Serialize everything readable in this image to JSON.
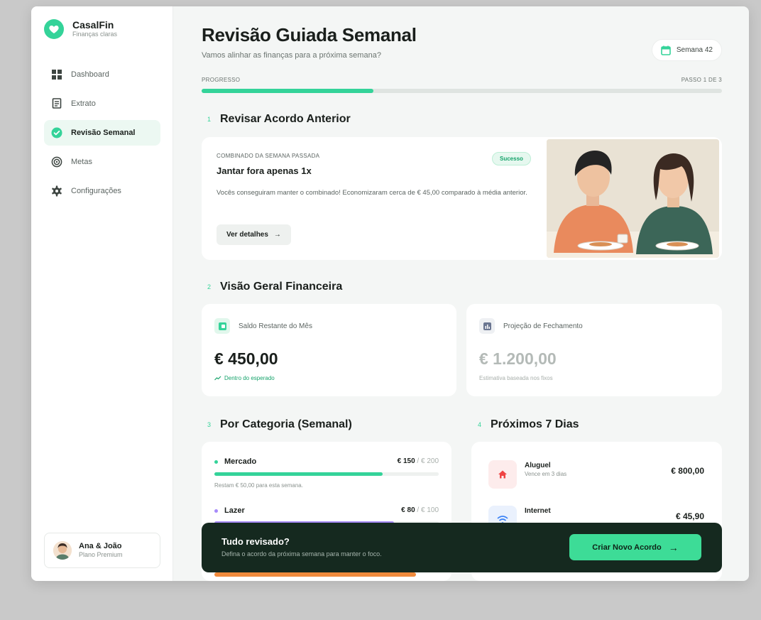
{
  "app": {
    "name": "CasalFin",
    "tagline": "Finanças claras"
  },
  "sidebar": {
    "items": [
      {
        "label": "Dashboard",
        "icon": "dashboard-icon",
        "active": false
      },
      {
        "label": "Extrato",
        "icon": "receipt-icon",
        "active": false
      },
      {
        "label": "Revisão Semanal",
        "icon": "check-circle-icon",
        "active": true
      },
      {
        "label": "Metas",
        "icon": "target-icon",
        "active": false
      },
      {
        "label": "Configurações",
        "icon": "gear-icon",
        "active": false
      }
    ],
    "user": {
      "name": "Ana & João",
      "plan": "Plano Premium"
    }
  },
  "header": {
    "title": "Revisão Guiada Semanal",
    "subtitle": "Vamos alinhar as finanças para a próxima semana?",
    "week_label": "Semana 42"
  },
  "progress": {
    "label": "PROGRESSO",
    "step_label": "PASSO 1 DE 3",
    "value": 0.33
  },
  "sections": {
    "agreement": {
      "number": "1",
      "title": "Revisar Acordo Anterior"
    },
    "overview": {
      "number": "2",
      "title": "Visão Geral Financeira"
    },
    "categories": {
      "number": "3",
      "title": "Por Categoria (Semanal)"
    },
    "upcoming": {
      "number": "4",
      "title": "Próximos 7 Dias"
    }
  },
  "agreement": {
    "tag": "COMBINADO DA SEMANA PASSADA",
    "title": "Jantar fora apenas 1x",
    "badge": "Sucesso",
    "description": "Vocês conseguiram manter o combinado! Economizaram cerca de € 45,00 comparado à média anterior.",
    "button_label": "Ver detalhes",
    "button_arrow": "→"
  },
  "overview": {
    "balance": {
      "label": "Saldo Restante do Mês",
      "value": "€ 450,00",
      "note": "Dentro do esperado"
    },
    "projection": {
      "label": "Projeção de Fechamento",
      "value": "€ 1.200,00",
      "note": "Estimativa baseada nos fixos"
    }
  },
  "categories": [
    {
      "name": "Mercado",
      "spent": "€ 150",
      "limit": " / € 200",
      "progress": 0.75,
      "color": "#34d399",
      "note": "Restam € 50,00 para esta semana."
    },
    {
      "name": "Lazer",
      "spent": "€ 80",
      "limit": " / € 100",
      "progress": 0.8,
      "color": "#a78bfa",
      "note": ""
    }
  ],
  "upcoming": [
    {
      "name": "Aluguel",
      "due": "Vence em 3 dias",
      "amount": "€ 800,00",
      "icon": "home-icon",
      "color": "#ef4444"
    },
    {
      "name": "Internet",
      "due": "",
      "amount": "€ 45,90",
      "icon": "wifi-icon",
      "color": "#3b82f6"
    }
  ],
  "footer": {
    "title": "Tudo revisado?",
    "subtitle": "Defina o acordo da próxima semana para manter o foco.",
    "button_label": "Criar Novo Acordo",
    "button_arrow": "→"
  },
  "colors": {
    "accent": "#34d399",
    "footer_bg": "#15291f"
  }
}
